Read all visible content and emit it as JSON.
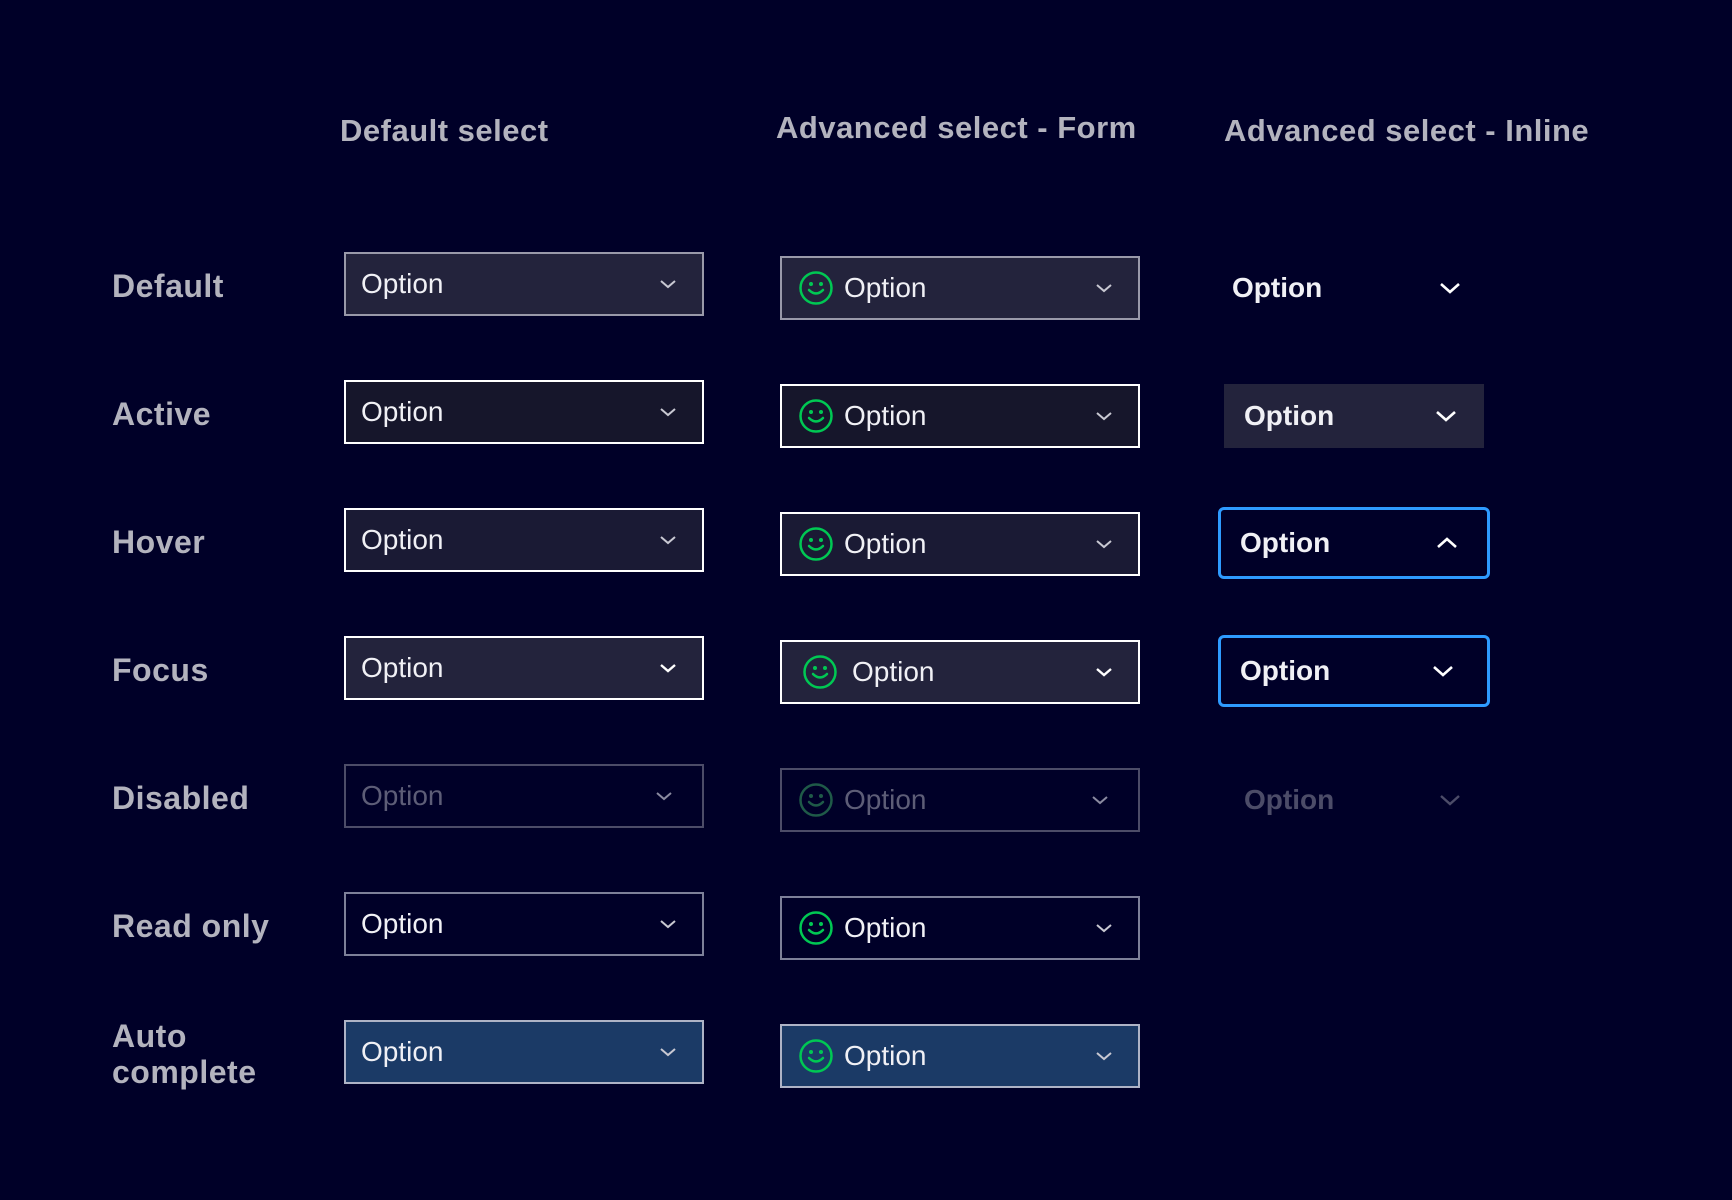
{
  "columns": {
    "default_select": "Default select",
    "advanced_form": "Advanced select - Form",
    "advanced_inline": "Advanced select - Inline"
  },
  "rows": {
    "default": "Default",
    "active": "Active",
    "hover": "Hover",
    "focus": "Focus",
    "disabled": "Disabled",
    "read_only": "Read only",
    "auto_complete_line1": "Auto",
    "auto_complete_line2": "complete"
  },
  "option_label": "Option",
  "icons": {
    "chevron": "chevron-down-icon",
    "chevron_up": "chevron-up-icon",
    "avatar": "smiley-icon"
  },
  "colors": {
    "background": "#000028",
    "smiley": "#00c853",
    "focus_border": "#2e9bff",
    "autocomplete_bg": "#1b3a66"
  }
}
